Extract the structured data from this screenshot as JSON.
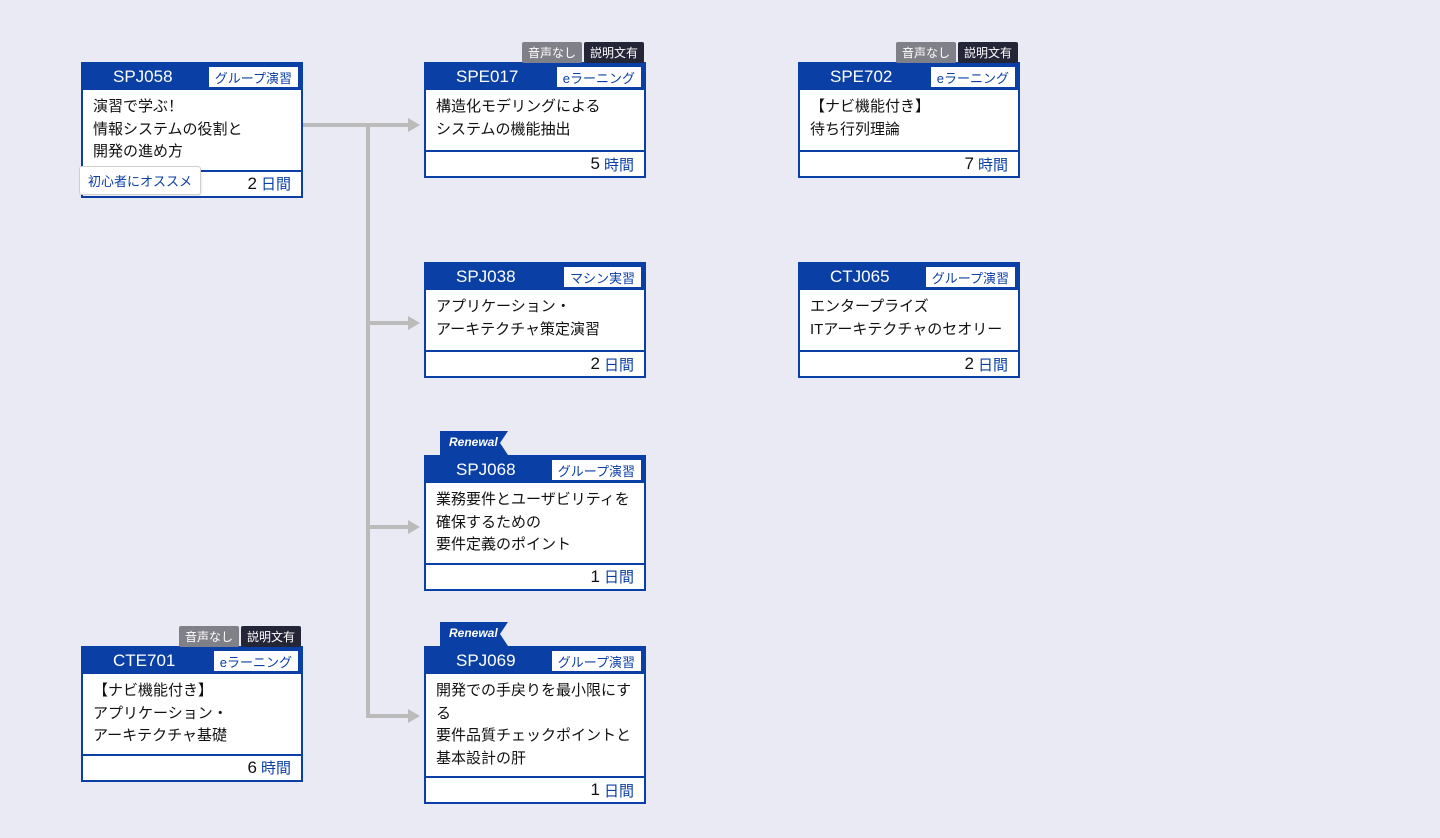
{
  "labels": {
    "no_audio": "音声なし",
    "has_desc": "説明文有",
    "renewal": "Renewal",
    "recommend": "初心者にオススメ"
  },
  "cards": {
    "spj058": {
      "code": "SPJ058",
      "type": "グループ演習",
      "body": "演習で学ぶ！\n情報システムの役割と\n開発の進め方",
      "duration_num": "2",
      "duration_unit": "日間"
    },
    "spe017": {
      "code": "SPE017",
      "type": "eラーニング",
      "body": "構造化モデリングによる\nシステムの機能抽出",
      "duration_num": "5",
      "duration_unit": "時間"
    },
    "spe702": {
      "code": "SPE702",
      "type": "eラーニング",
      "body": "【ナビ機能付き】\n待ち行列理論",
      "duration_num": "7",
      "duration_unit": "時間"
    },
    "spj038": {
      "code": "SPJ038",
      "type": "マシン実習",
      "body": "アプリケーション・\nアーキテクチャ策定演習",
      "duration_num": "2",
      "duration_unit": "日間"
    },
    "ctj065": {
      "code": "CTJ065",
      "type": "グループ演習",
      "body": "エンタープライズ\nITアーキテクチャのセオリー",
      "duration_num": "2",
      "duration_unit": "日間"
    },
    "spj068": {
      "code": "SPJ068",
      "type": "グループ演習",
      "body": "業務要件とユーザビリティを\n確保するための\n要件定義のポイント",
      "duration_num": "1",
      "duration_unit": "日間"
    },
    "spj069": {
      "code": "SPJ069",
      "type": "グループ演習",
      "body": "開発での手戻りを最小限にする\n要件品質チェックポイントと\n基本設計の肝",
      "duration_num": "1",
      "duration_unit": "日間"
    },
    "cte701": {
      "code": "CTE701",
      "type": "eラーニング",
      "body": "【ナビ機能付き】\nアプリケーション・\nアーキテクチャ基礎",
      "duration_num": "6",
      "duration_unit": "時間"
    }
  },
  "connectors": [
    {
      "from": "spj058",
      "to": "spe017"
    },
    {
      "from": "spj058",
      "to": "spj038"
    },
    {
      "from": "spj058",
      "to": "spj068"
    },
    {
      "from": "spj058",
      "to": "spj069"
    }
  ]
}
